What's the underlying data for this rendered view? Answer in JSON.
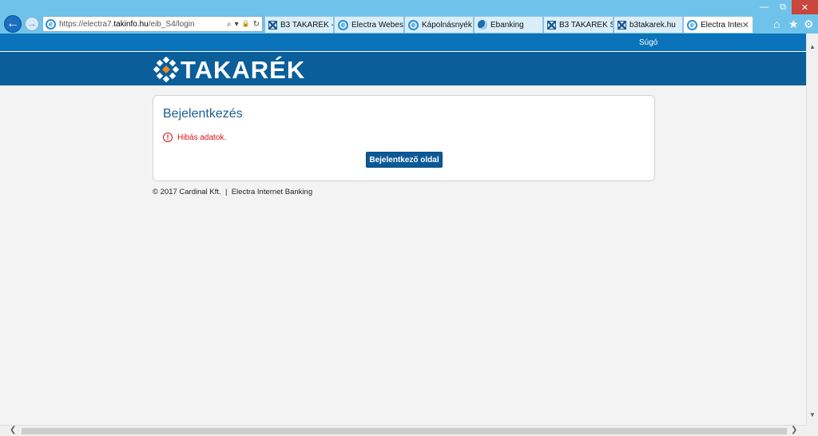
{
  "browser": {
    "url_prefix": "https://electra7.",
    "url_domain": "takinfo.hu",
    "url_path": "/eib_S4/login",
    "window_controls": {
      "minimize": "—",
      "maximize": "⧉",
      "close": "✕"
    },
    "nav": {
      "back": "←",
      "forward": "→"
    },
    "address_tools": {
      "search": "⌕",
      "dropdown": "▾",
      "lock": "🔒",
      "refresh": "↻"
    },
    "tabs": [
      {
        "label": "B3 TAKARÉK - ...",
        "icon": "grid-icon"
      },
      {
        "label": "Electra Webes ...",
        "icon": "ie-icon"
      },
      {
        "label": "Kápolnásnyék ...",
        "icon": "ie-icon"
      },
      {
        "label": "Ebanking",
        "icon": "ebanking-icon"
      },
      {
        "label": "B3 TAKARÉK S...",
        "icon": "grid-icon"
      },
      {
        "label": "b3takarek.hu",
        "icon": "grid-icon"
      },
      {
        "label": "Electra Inter...",
        "icon": "ie-icon",
        "active": true,
        "close": "✕"
      }
    ],
    "icons": {
      "home": "⌂",
      "favorites": "★",
      "settings": "⚙",
      "ie_glyph": "e"
    }
  },
  "page": {
    "help_link": "Súgó",
    "logo_text": "TAKARÉK",
    "card": {
      "title": "Bejelentkezés",
      "error_icon_glyph": "!",
      "error_message": "Hibás adatok.",
      "button_label": "Bejelentkező oldal"
    },
    "footer": "© 2017 Cardinal Kft.  |  Electra Internet Banking"
  },
  "scrollbars": {
    "up": "▲",
    "down": "▼",
    "left": "❮",
    "right": "❯"
  },
  "colors": {
    "chrome": "#6fc3ea",
    "top_strip": "#0a73b9",
    "banner": "#0a5e9a",
    "title": "#1a5d94",
    "error": "#d8121d",
    "button": "#0b5a96"
  }
}
